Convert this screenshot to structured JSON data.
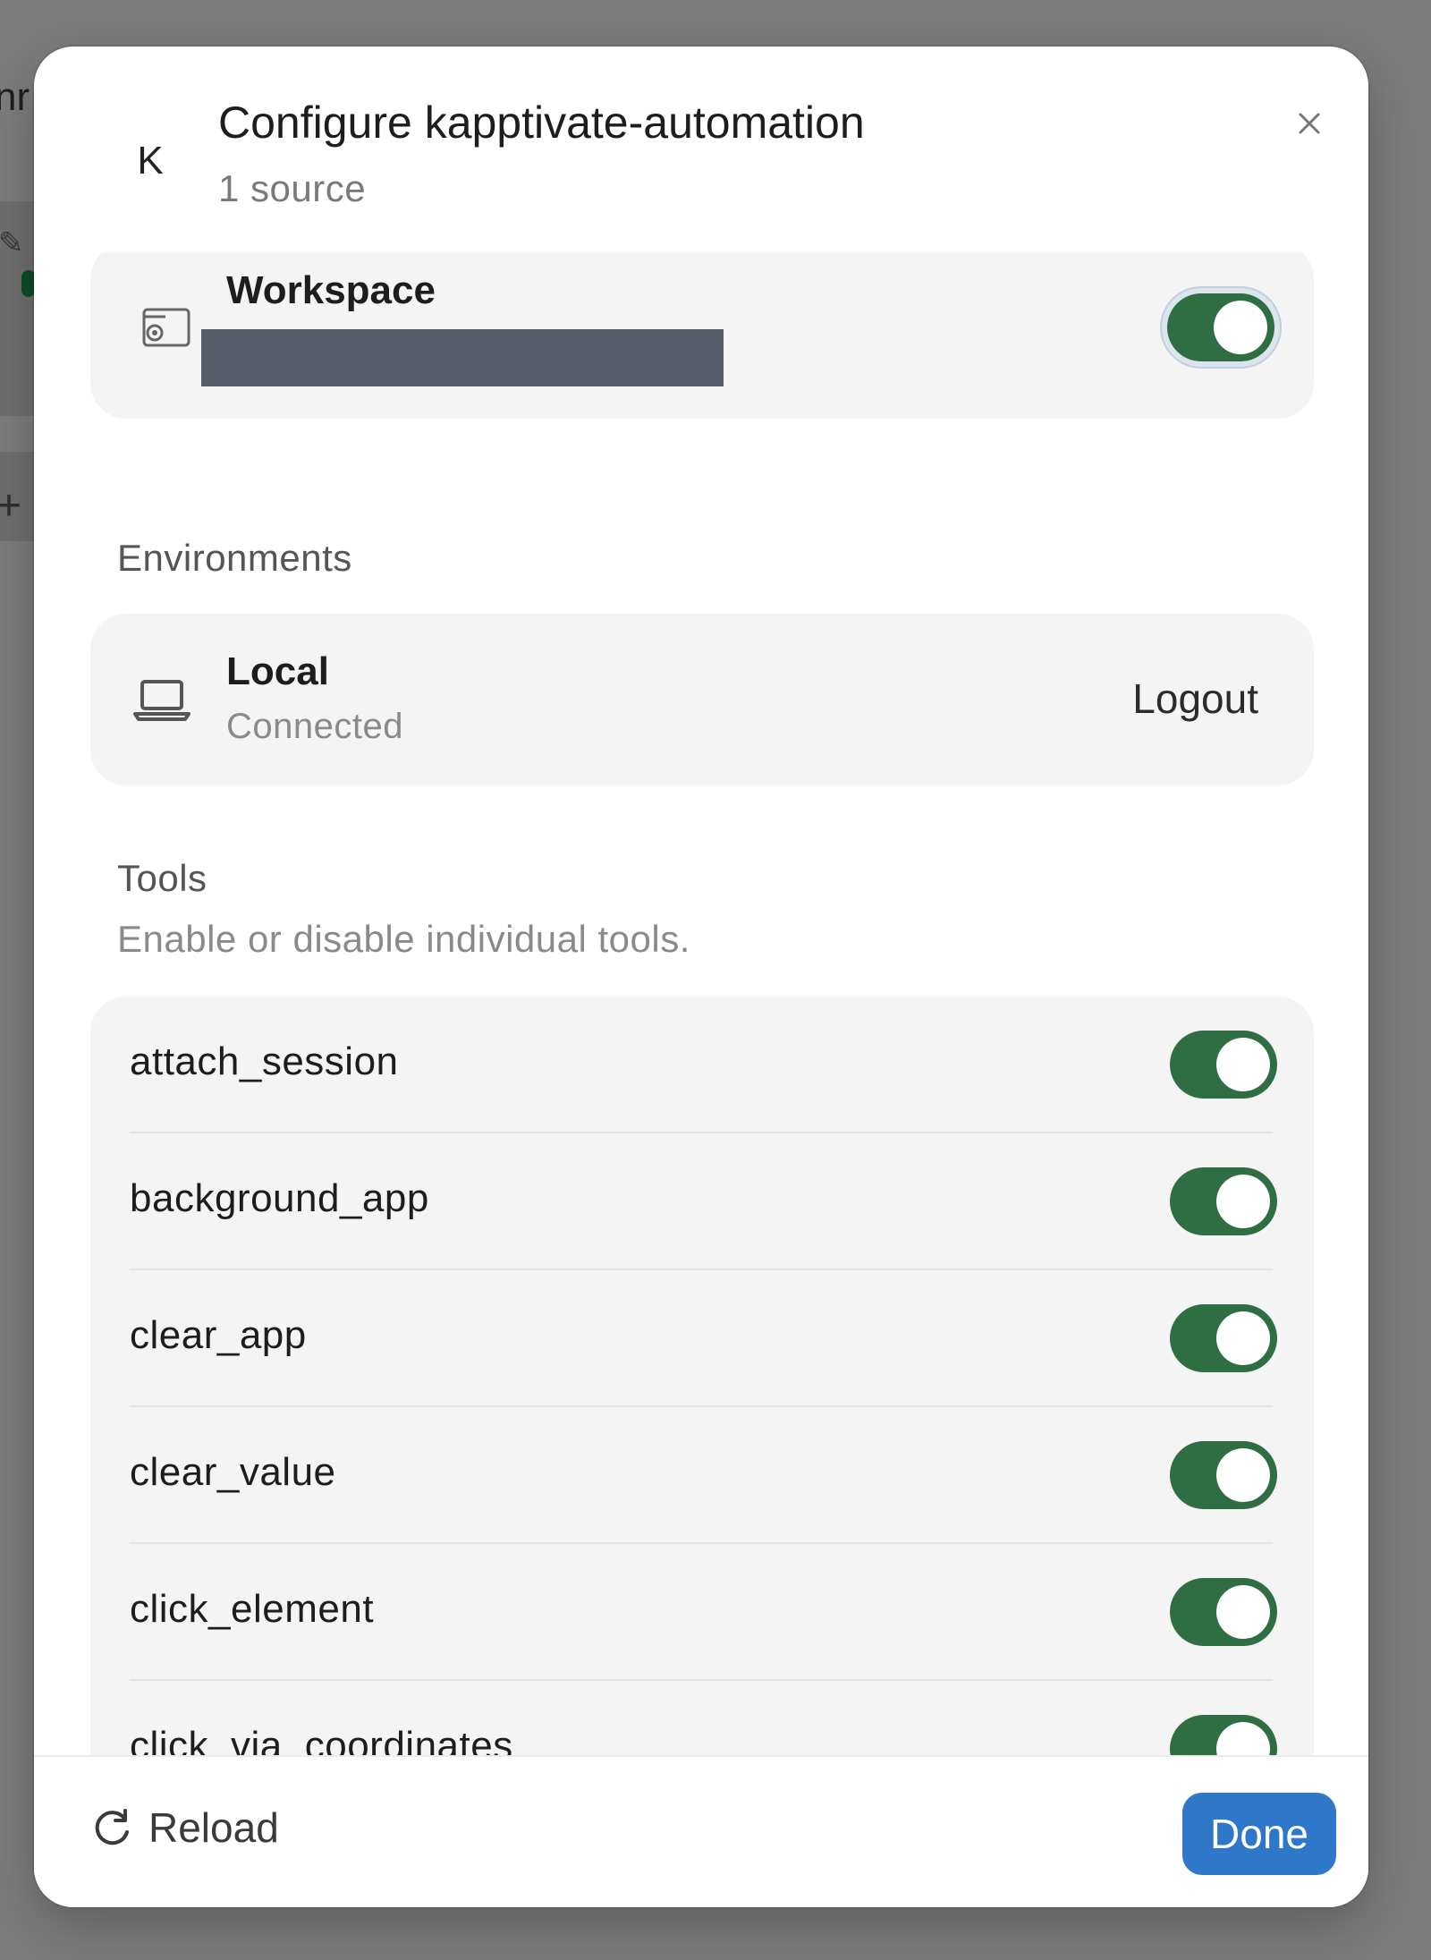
{
  "background": {
    "text_fragment": "nr"
  },
  "dialog": {
    "logo_text": "K",
    "title": "Configure kapptivate-automation",
    "subtitle": "1 source",
    "close_icon": "close-icon"
  },
  "workspace": {
    "label": "Workspace",
    "icon": "folder-source-icon",
    "enabled": true
  },
  "environments": {
    "heading": "Environments",
    "items": [
      {
        "name": "Local",
        "status": "Connected",
        "action": "Logout",
        "icon": "laptop-icon"
      }
    ]
  },
  "tools": {
    "heading": "Tools",
    "description": "Enable or disable individual tools.",
    "items": [
      {
        "name": "attach_session",
        "enabled": true
      },
      {
        "name": "background_app",
        "enabled": true
      },
      {
        "name": "clear_app",
        "enabled": true
      },
      {
        "name": "clear_value",
        "enabled": true
      },
      {
        "name": "click_element",
        "enabled": true
      },
      {
        "name": "click_via_coordinates",
        "enabled": true
      }
    ]
  },
  "footer": {
    "reload_label": "Reload",
    "done_label": "Done"
  },
  "colors": {
    "toggle_on": "#2e6e42",
    "primary_button": "#2f77c8",
    "card_background": "#f4f4f4"
  }
}
